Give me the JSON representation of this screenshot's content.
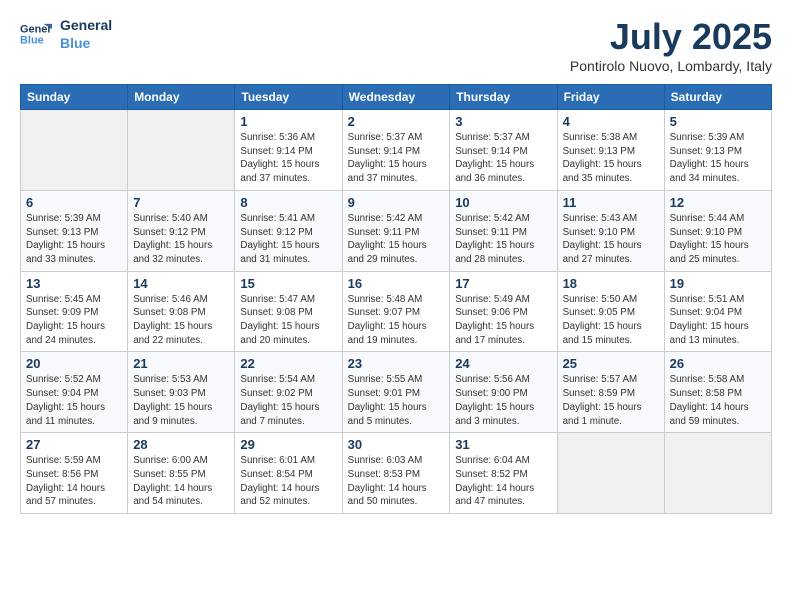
{
  "header": {
    "logo_line1": "General",
    "logo_line2": "Blue",
    "month_title": "July 2025",
    "location": "Pontirolo Nuovo, Lombardy, Italy"
  },
  "days_of_week": [
    "Sunday",
    "Monday",
    "Tuesday",
    "Wednesday",
    "Thursday",
    "Friday",
    "Saturday"
  ],
  "weeks": [
    [
      {
        "num": "",
        "detail": ""
      },
      {
        "num": "",
        "detail": ""
      },
      {
        "num": "1",
        "detail": "Sunrise: 5:36 AM\nSunset: 9:14 PM\nDaylight: 15 hours and 37 minutes."
      },
      {
        "num": "2",
        "detail": "Sunrise: 5:37 AM\nSunset: 9:14 PM\nDaylight: 15 hours and 37 minutes."
      },
      {
        "num": "3",
        "detail": "Sunrise: 5:37 AM\nSunset: 9:14 PM\nDaylight: 15 hours and 36 minutes."
      },
      {
        "num": "4",
        "detail": "Sunrise: 5:38 AM\nSunset: 9:13 PM\nDaylight: 15 hours and 35 minutes."
      },
      {
        "num": "5",
        "detail": "Sunrise: 5:39 AM\nSunset: 9:13 PM\nDaylight: 15 hours and 34 minutes."
      }
    ],
    [
      {
        "num": "6",
        "detail": "Sunrise: 5:39 AM\nSunset: 9:13 PM\nDaylight: 15 hours and 33 minutes."
      },
      {
        "num": "7",
        "detail": "Sunrise: 5:40 AM\nSunset: 9:12 PM\nDaylight: 15 hours and 32 minutes."
      },
      {
        "num": "8",
        "detail": "Sunrise: 5:41 AM\nSunset: 9:12 PM\nDaylight: 15 hours and 31 minutes."
      },
      {
        "num": "9",
        "detail": "Sunrise: 5:42 AM\nSunset: 9:11 PM\nDaylight: 15 hours and 29 minutes."
      },
      {
        "num": "10",
        "detail": "Sunrise: 5:42 AM\nSunset: 9:11 PM\nDaylight: 15 hours and 28 minutes."
      },
      {
        "num": "11",
        "detail": "Sunrise: 5:43 AM\nSunset: 9:10 PM\nDaylight: 15 hours and 27 minutes."
      },
      {
        "num": "12",
        "detail": "Sunrise: 5:44 AM\nSunset: 9:10 PM\nDaylight: 15 hours and 25 minutes."
      }
    ],
    [
      {
        "num": "13",
        "detail": "Sunrise: 5:45 AM\nSunset: 9:09 PM\nDaylight: 15 hours and 24 minutes."
      },
      {
        "num": "14",
        "detail": "Sunrise: 5:46 AM\nSunset: 9:08 PM\nDaylight: 15 hours and 22 minutes."
      },
      {
        "num": "15",
        "detail": "Sunrise: 5:47 AM\nSunset: 9:08 PM\nDaylight: 15 hours and 20 minutes."
      },
      {
        "num": "16",
        "detail": "Sunrise: 5:48 AM\nSunset: 9:07 PM\nDaylight: 15 hours and 19 minutes."
      },
      {
        "num": "17",
        "detail": "Sunrise: 5:49 AM\nSunset: 9:06 PM\nDaylight: 15 hours and 17 minutes."
      },
      {
        "num": "18",
        "detail": "Sunrise: 5:50 AM\nSunset: 9:05 PM\nDaylight: 15 hours and 15 minutes."
      },
      {
        "num": "19",
        "detail": "Sunrise: 5:51 AM\nSunset: 9:04 PM\nDaylight: 15 hours and 13 minutes."
      }
    ],
    [
      {
        "num": "20",
        "detail": "Sunrise: 5:52 AM\nSunset: 9:04 PM\nDaylight: 15 hours and 11 minutes."
      },
      {
        "num": "21",
        "detail": "Sunrise: 5:53 AM\nSunset: 9:03 PM\nDaylight: 15 hours and 9 minutes."
      },
      {
        "num": "22",
        "detail": "Sunrise: 5:54 AM\nSunset: 9:02 PM\nDaylight: 15 hours and 7 minutes."
      },
      {
        "num": "23",
        "detail": "Sunrise: 5:55 AM\nSunset: 9:01 PM\nDaylight: 15 hours and 5 minutes."
      },
      {
        "num": "24",
        "detail": "Sunrise: 5:56 AM\nSunset: 9:00 PM\nDaylight: 15 hours and 3 minutes."
      },
      {
        "num": "25",
        "detail": "Sunrise: 5:57 AM\nSunset: 8:59 PM\nDaylight: 15 hours and 1 minute."
      },
      {
        "num": "26",
        "detail": "Sunrise: 5:58 AM\nSunset: 8:58 PM\nDaylight: 14 hours and 59 minutes."
      }
    ],
    [
      {
        "num": "27",
        "detail": "Sunrise: 5:59 AM\nSunset: 8:56 PM\nDaylight: 14 hours and 57 minutes."
      },
      {
        "num": "28",
        "detail": "Sunrise: 6:00 AM\nSunset: 8:55 PM\nDaylight: 14 hours and 54 minutes."
      },
      {
        "num": "29",
        "detail": "Sunrise: 6:01 AM\nSunset: 8:54 PM\nDaylight: 14 hours and 52 minutes."
      },
      {
        "num": "30",
        "detail": "Sunrise: 6:03 AM\nSunset: 8:53 PM\nDaylight: 14 hours and 50 minutes."
      },
      {
        "num": "31",
        "detail": "Sunrise: 6:04 AM\nSunset: 8:52 PM\nDaylight: 14 hours and 47 minutes."
      },
      {
        "num": "",
        "detail": ""
      },
      {
        "num": "",
        "detail": ""
      }
    ]
  ]
}
